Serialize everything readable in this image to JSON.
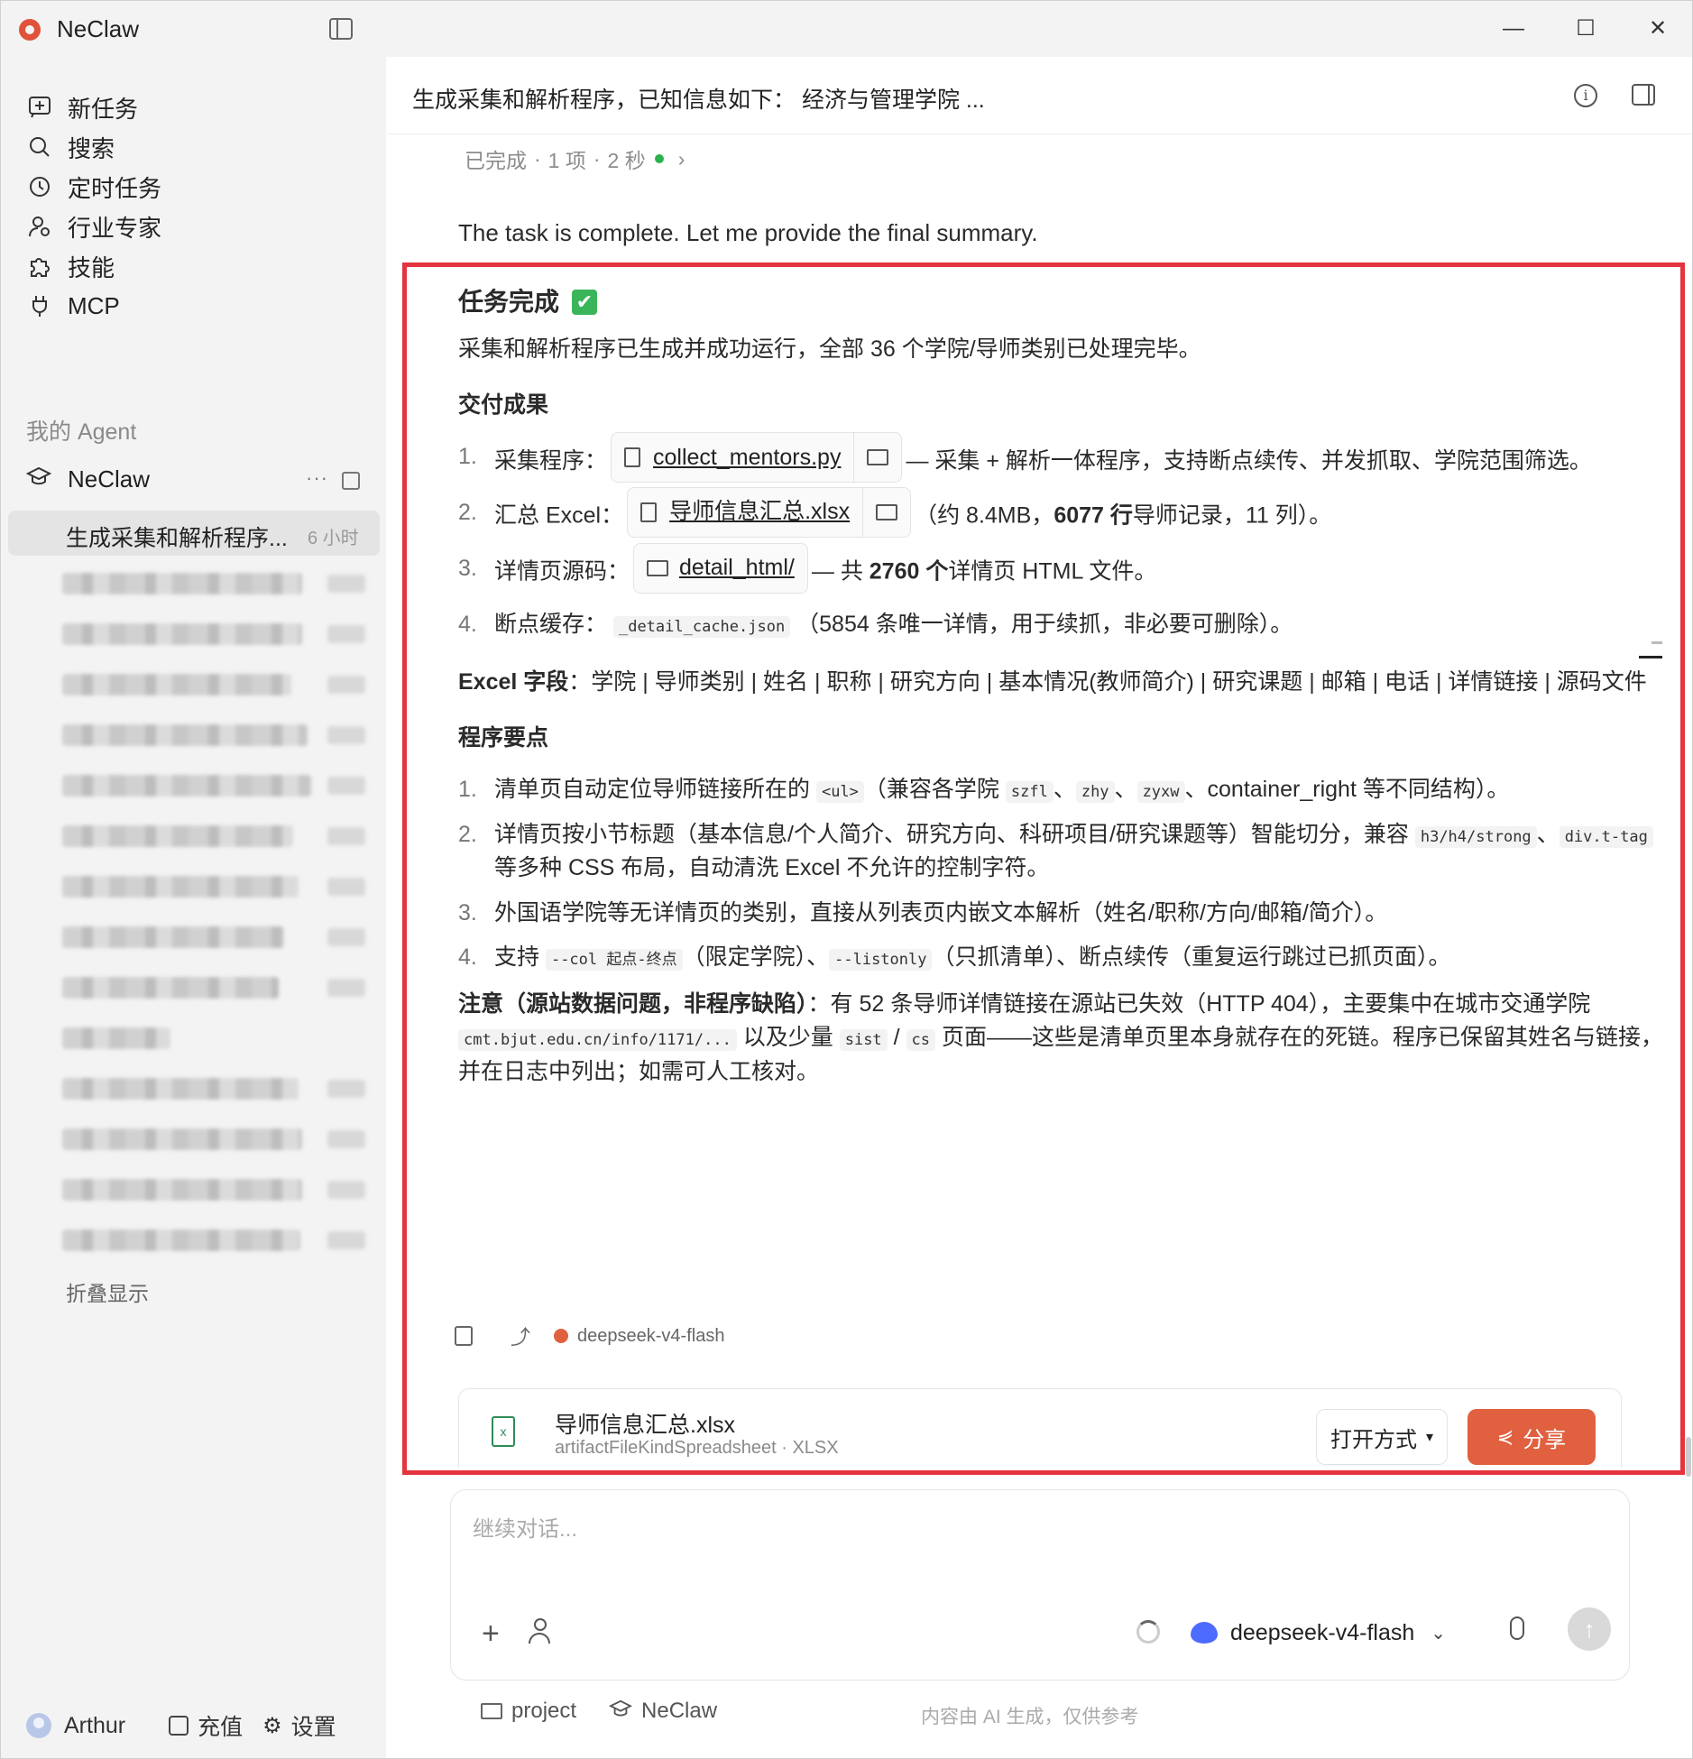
{
  "app": {
    "name": "NeClaw"
  },
  "window_controls": {
    "minimize": "—",
    "maximize": "☐",
    "close": "✕"
  },
  "sidebar": {
    "nav": [
      {
        "label": "新任务",
        "icon": "new-task-icon"
      },
      {
        "label": "搜索",
        "icon": "search-icon"
      },
      {
        "label": "定时任务",
        "icon": "clock-icon"
      },
      {
        "label": "行业专家",
        "icon": "expert-icon"
      },
      {
        "label": "技能",
        "icon": "puzzle-icon"
      },
      {
        "label": "MCP",
        "icon": "plug-icon"
      }
    ],
    "section_title": "我的 Agent",
    "agent": {
      "name": "NeClaw",
      "more": "···"
    },
    "active_conversation": {
      "title": "生成采集和解析程序...",
      "time": "6 小时"
    },
    "collapse_label": "折叠显示",
    "user": {
      "name": "Arthur",
      "recharge": "充值",
      "settings": "设置"
    }
  },
  "header": {
    "title": "生成采集和解析程序，已知信息如下： 经济与管理学院 ..."
  },
  "status": {
    "state": "已完成",
    "sep1": "·",
    "count": "1 项",
    "sep2": "·",
    "duration": "2 秒",
    "arrow": "›"
  },
  "message": {
    "lead": "The task is complete. Let me provide the final summary.",
    "heading": "任务完成",
    "check": "✔",
    "intro": "采集和解析程序已生成并成功运行，全部 36 个学院/导师类别已处理完毕。",
    "deliverables_title": "交付成果",
    "d1": {
      "num": "1.",
      "label": "采集程序：",
      "file": "collect_mentors.py",
      "desc": "— 采集 + 解析一体程序，支持断点续传、并发抓取、学院范围筛选。"
    },
    "d2": {
      "num": "2.",
      "label": "汇总 Excel：",
      "file": "导师信息汇总.xlsx",
      "pre": "（约 8.4MB，",
      "bold": "6077 行",
      "post": "导师记录，11 列）。"
    },
    "d3": {
      "num": "3.",
      "label": "详情页源码：",
      "file": "detail_html/",
      "pre": "— 共 ",
      "bold": "2760 个",
      "post": "详情页 HTML 文件。"
    },
    "d4": {
      "num": "4.",
      "label": "断点缓存：",
      "code": "_detail_cache.json",
      "post": "（5854 条唯一详情，用于续抓，非必要可删除）。"
    },
    "excel_fields_label": "Excel 字段",
    "excel_fields": "：学院 | 导师类别 | 姓名 | 职称 | 研究方向 | 基本情况(教师简介) | 研究课题 | 邮箱 | 电话 | 详情链接 | 源码文件",
    "points_title": "程序要点",
    "p1": {
      "num": "1.",
      "a": "清单页自动定位导师链接所在的 ",
      "c1": "<ul>",
      "b": "（兼容各学院 ",
      "c2": "szfl",
      "s1": "、",
      "c3": "zhy",
      "s2": "、",
      "c4": "zyxw",
      "d": "、container_right 等不同结构）。"
    },
    "p2": {
      "num": "2.",
      "a": "详情页按小节标题（基本信息/个人简介、研究方向、科研项目/研究课题等）智能切分，兼容 ",
      "c1": "h3/h4/strong",
      "s1": "、",
      "c2": "div.t-tag",
      "b": " 等多种 CSS 布局，自动清洗 Excel 不允许的控制字符。"
    },
    "p3": {
      "num": "3.",
      "a": "外国语学院等无详情页的类别，直接从列表页内嵌文本解析（姓名/职称/方向/邮箱/简介）。"
    },
    "p4": {
      "num": "4.",
      "a": "支持 ",
      "c1": "--col 起点-终点",
      "b": "（限定学院）、",
      "c2": "--listonly",
      "d": "（只抓清单）、断点续传（重复运行跳过已抓页面）。"
    },
    "note_bold": "注意（源站数据问题，非程序缺陷）",
    "note_a": "：有 52 条导师详情链接在源站已失效（HTTP 404），主要集中在城市交通学院 ",
    "note_code1": "cmt.bjut.edu.cn/info/1171/...",
    "note_b": " 以及少量 ",
    "note_code2": "sist",
    "note_slash": " / ",
    "note_code3": "cs",
    "note_c": " 页面——这些是清单页里本身就存在的死链。程序已保留其姓名与链接，并在日志中列出；如需可人工核对。",
    "model": "deepseek-v4-flash"
  },
  "file_card": {
    "name": "导师信息汇总.xlsx",
    "sub": "artifactFileKindSpreadsheet · XLSX",
    "open_with": "打开方式",
    "share": "分享",
    "icon_text": "x"
  },
  "composer": {
    "placeholder": "继续对话...",
    "model": "deepseek-v4-flash",
    "plus": "+",
    "send": "↑"
  },
  "footer": {
    "project": "project",
    "agent": "NeClaw",
    "disclaimer": "内容由 AI 生成，仅供参考"
  },
  "colors": {
    "accent": "#e0603f",
    "highlight": "#e4343f",
    "done": "#2bb24c"
  }
}
